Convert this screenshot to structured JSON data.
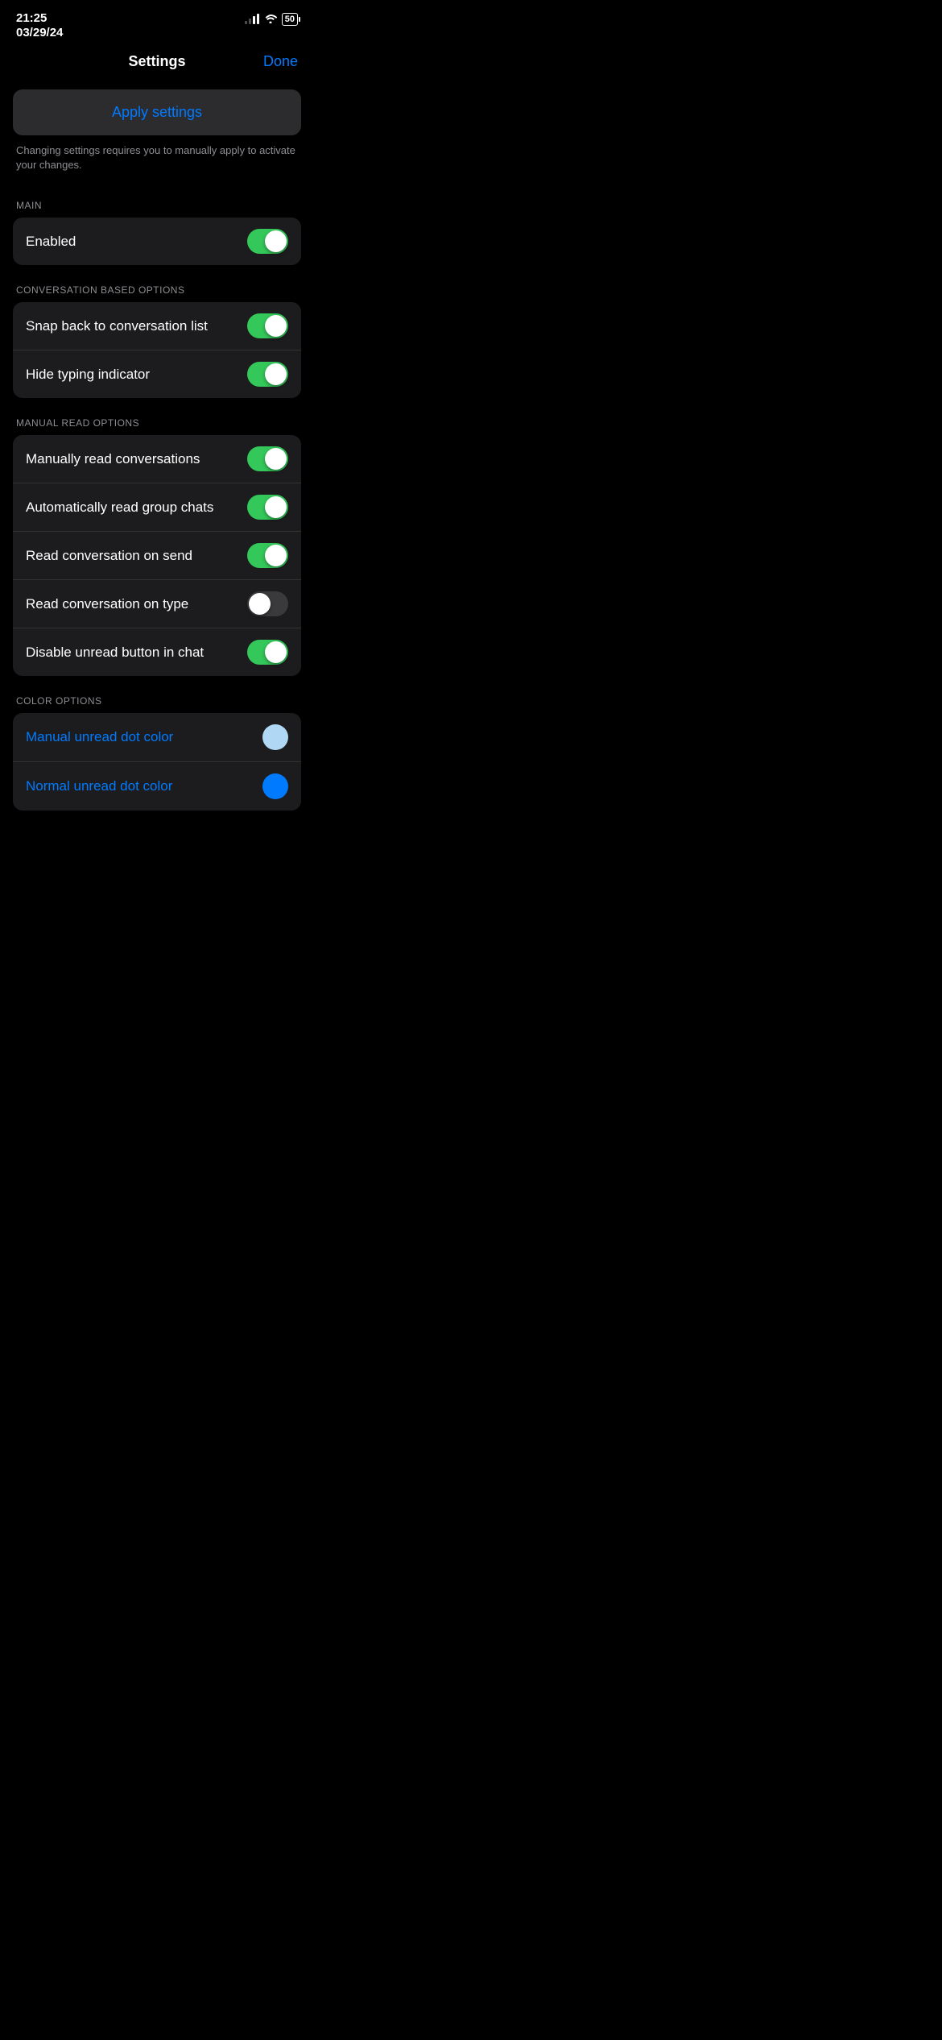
{
  "status": {
    "time": "21:25",
    "date": "03/29/24",
    "battery": "50"
  },
  "nav": {
    "title": "Settings",
    "done": "Done"
  },
  "apply": {
    "button_label": "Apply settings",
    "description": "Changing settings requires you to manually apply to activate your changes."
  },
  "sections": [
    {
      "label": "MAIN",
      "rows": [
        {
          "id": "enabled",
          "label": "Enabled",
          "type": "toggle",
          "state": "on",
          "label_color": "white"
        }
      ]
    },
    {
      "label": "CONVERSATION BASED OPTIONS",
      "rows": [
        {
          "id": "snap-back",
          "label": "Snap back to conversation list",
          "type": "toggle",
          "state": "on",
          "label_color": "white"
        },
        {
          "id": "hide-typing",
          "label": "Hide typing indicator",
          "type": "toggle",
          "state": "on",
          "label_color": "white"
        }
      ]
    },
    {
      "label": "MANUAL READ OPTIONS",
      "rows": [
        {
          "id": "manually-read",
          "label": "Manually read conversations",
          "type": "toggle",
          "state": "on",
          "label_color": "white"
        },
        {
          "id": "auto-group",
          "label": "Automatically read group chats",
          "type": "toggle",
          "state": "on",
          "label_color": "white"
        },
        {
          "id": "read-send",
          "label": "Read conversation on send",
          "type": "toggle",
          "state": "on",
          "label_color": "white"
        },
        {
          "id": "read-type",
          "label": "Read conversation on type",
          "type": "toggle",
          "state": "off",
          "label_color": "white"
        },
        {
          "id": "disable-unread",
          "label": "Disable unread button in chat",
          "type": "toggle",
          "state": "on",
          "label_color": "white"
        }
      ]
    },
    {
      "label": "COLOR OPTIONS",
      "rows": [
        {
          "id": "manual-dot-color",
          "label": "Manual unread dot color",
          "type": "color",
          "color": "#b0d8f5",
          "label_color": "blue"
        },
        {
          "id": "normal-dot-color",
          "label": "Normal unread dot color",
          "type": "color",
          "color": "#007AFF",
          "label_color": "blue"
        }
      ]
    }
  ]
}
